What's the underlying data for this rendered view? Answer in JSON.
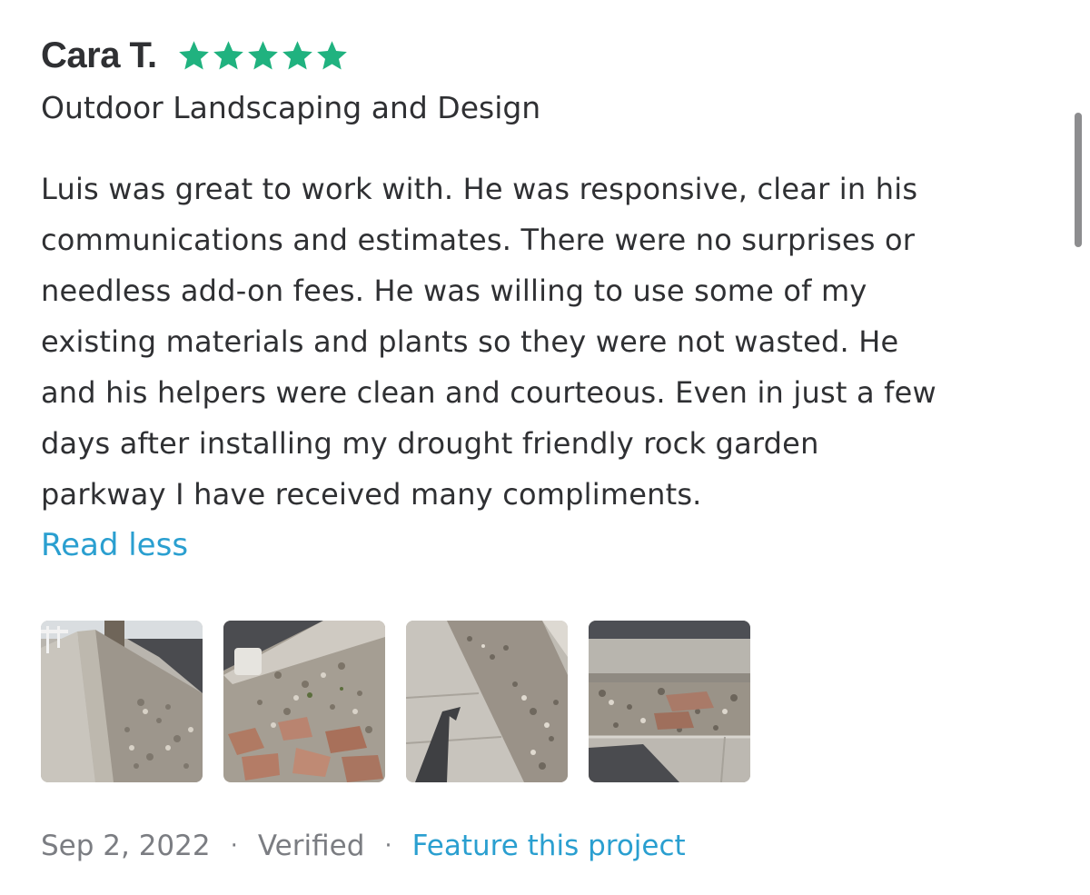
{
  "review": {
    "reviewer_name": "Cara T.",
    "rating": 5,
    "star_color": "#20b27f",
    "category": "Outdoor Landscaping and Design",
    "text_lines": [
      "Luis was great to work with. He was responsive, clear in his",
      "communications and estimates. There were no surprises or",
      "needless add-on fees. He was willing to use some of my",
      "existing materials and plants so they were not wasted. He",
      "and his helpers were clean and courteous. Even in just a few",
      "days after installing my drought friendly rock garden",
      "parkway I have received many compliments."
    ],
    "read_less_label": "Read less",
    "photos": [
      {
        "icon": "landscape-photo-sidewalk-and-rocks"
      },
      {
        "icon": "landscape-photo-rocks-and-flagstones"
      },
      {
        "icon": "landscape-photo-sidewalk-shadow"
      },
      {
        "icon": "landscape-photo-parkway-street"
      }
    ],
    "date": "Sep 2, 2022",
    "separator": "·",
    "verified_label": "Verified",
    "feature_label": "Feature this project"
  },
  "colors": {
    "text": "#2f3033",
    "muted": "#7b7d82",
    "link": "#2a9fd0",
    "star": "#20b27f"
  }
}
